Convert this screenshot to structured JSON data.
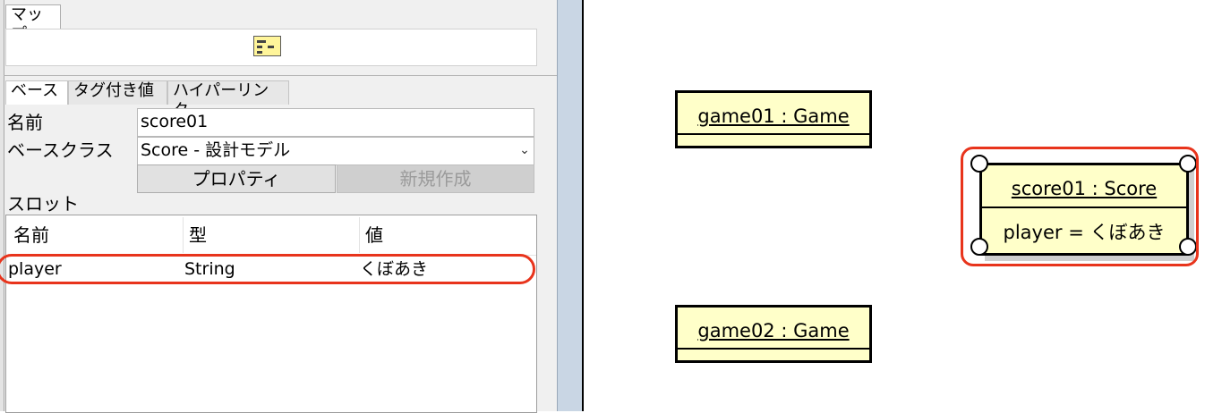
{
  "map_panel": {
    "tab_label": "マップ"
  },
  "tabs": [
    {
      "label": "ベース",
      "active": true
    },
    {
      "label": "タグ付き値",
      "active": false
    },
    {
      "label": "ハイパーリンク",
      "active": false
    }
  ],
  "form": {
    "name_label": "名前",
    "name_value": "score01",
    "base_class_label": "ベースクラス",
    "base_class_value": "Score - 設計モデル",
    "properties_button": "プロパティ",
    "new_button": "新規作成"
  },
  "slots": {
    "label": "スロット",
    "columns": [
      "名前",
      "型",
      "値"
    ],
    "rows": [
      {
        "name": "player",
        "type": "String",
        "value": "くぼあき"
      }
    ]
  },
  "diagram": {
    "objects": [
      {
        "name": "game01 : Game",
        "attributes": []
      },
      {
        "name": "score01 : Score",
        "attributes": [
          "player = くぼあき"
        ],
        "selected": true
      },
      {
        "name": "game02 : Game",
        "attributes": []
      }
    ]
  },
  "colors": {
    "object_fill": "#ffffc9",
    "highlight": "#e8341c",
    "splitter": "#c9d6e4"
  }
}
